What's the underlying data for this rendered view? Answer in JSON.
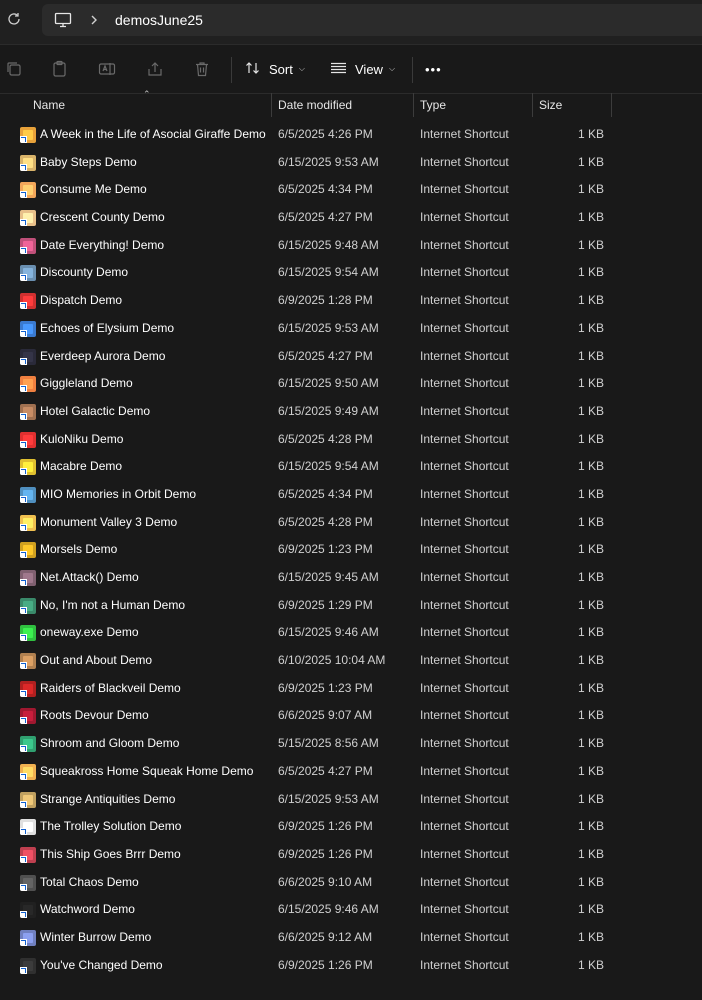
{
  "address": {
    "crumb": "demosJune25"
  },
  "toolbar": {
    "sort_label": "Sort",
    "view_label": "View",
    "more_label": "•••"
  },
  "columns": {
    "name": "Name",
    "date": "Date modified",
    "type": "Type",
    "size": "Size"
  },
  "files": [
    {
      "name": "A Week in the Life of Asocial Giraffe Demo",
      "date": "6/5/2025 4:26 PM",
      "type": "Internet Shortcut",
      "size": "1 KB",
      "color": "#e8a23a"
    },
    {
      "name": "Baby Steps Demo",
      "date": "6/15/2025 9:53 AM",
      "type": "Internet Shortcut",
      "size": "1 KB",
      "color": "#d9b36a"
    },
    {
      "name": "Consume Me Demo",
      "date": "6/5/2025 4:34 PM",
      "type": "Internet Shortcut",
      "size": "1 KB",
      "color": "#f2a65a"
    },
    {
      "name": "Crescent County Demo",
      "date": "6/5/2025 4:27 PM",
      "type": "Internet Shortcut",
      "size": "1 KB",
      "color": "#e8c08a"
    },
    {
      "name": "Date Everything! Demo",
      "date": "6/15/2025 9:48 AM",
      "type": "Internet Shortcut",
      "size": "1 KB",
      "color": "#c0507a"
    },
    {
      "name": "Discounty Demo",
      "date": "6/15/2025 9:54 AM",
      "type": "Internet Shortcut",
      "size": "1 KB",
      "color": "#6a8fb0"
    },
    {
      "name": "Dispatch Demo",
      "date": "6/9/2025 1:28 PM",
      "type": "Internet Shortcut",
      "size": "1 KB",
      "color": "#d03030"
    },
    {
      "name": "Echoes of Elysium Demo",
      "date": "6/15/2025 9:53 AM",
      "type": "Internet Shortcut",
      "size": "1 KB",
      "color": "#3a7ad0"
    },
    {
      "name": "Everdeep Aurora Demo",
      "date": "6/5/2025 4:27 PM",
      "type": "Internet Shortcut",
      "size": "1 KB",
      "color": "#2a2a3a"
    },
    {
      "name": "Giggleland Demo",
      "date": "6/15/2025 9:50 AM",
      "type": "Internet Shortcut",
      "size": "1 KB",
      "color": "#f08040"
    },
    {
      "name": "Hotel Galactic Demo",
      "date": "6/15/2025 9:49 AM",
      "type": "Internet Shortcut",
      "size": "1 KB",
      "color": "#a07050"
    },
    {
      "name": "KuloNiku Demo",
      "date": "6/5/2025 4:28 PM",
      "type": "Internet Shortcut",
      "size": "1 KB",
      "color": "#e03030"
    },
    {
      "name": "Macabre Demo",
      "date": "6/15/2025 9:54 AM",
      "type": "Internet Shortcut",
      "size": "1 KB",
      "color": "#e0c030"
    },
    {
      "name": "MIO Memories in Orbit Demo",
      "date": "6/5/2025 4:34 PM",
      "type": "Internet Shortcut",
      "size": "1 KB",
      "color": "#5090c0"
    },
    {
      "name": "Monument Valley 3 Demo",
      "date": "6/5/2025 4:28 PM",
      "type": "Internet Shortcut",
      "size": "1 KB",
      "color": "#f0c050"
    },
    {
      "name": "Morsels Demo",
      "date": "6/9/2025 1:23 PM",
      "type": "Internet Shortcut",
      "size": "1 KB",
      "color": "#d0a020"
    },
    {
      "name": "Net.Attack() Demo",
      "date": "6/15/2025 9:45 AM",
      "type": "Internet Shortcut",
      "size": "1 KB",
      "color": "#806070"
    },
    {
      "name": "No, I'm not a Human Demo",
      "date": "6/9/2025 1:29 PM",
      "type": "Internet Shortcut",
      "size": "1 KB",
      "color": "#3a8a6a"
    },
    {
      "name": "oneway.exe Demo",
      "date": "6/15/2025 9:46 AM",
      "type": "Internet Shortcut",
      "size": "1 KB",
      "color": "#30c040"
    },
    {
      "name": "Out and About Demo",
      "date": "6/10/2025 10:04 AM",
      "type": "Internet Shortcut",
      "size": "1 KB",
      "color": "#b08050"
    },
    {
      "name": "Raiders of Blackveil Demo",
      "date": "6/9/2025 1:23 PM",
      "type": "Internet Shortcut",
      "size": "1 KB",
      "color": "#b02020"
    },
    {
      "name": "Roots Devour Demo",
      "date": "6/6/2025 9:07 AM",
      "type": "Internet Shortcut",
      "size": "1 KB",
      "color": "#a01830"
    },
    {
      "name": "Shroom and Gloom Demo",
      "date": "5/15/2025 8:56 AM",
      "type": "Internet Shortcut",
      "size": "1 KB",
      "color": "#30a070"
    },
    {
      "name": "Squeakross Home Squeak Home Demo",
      "date": "6/5/2025 4:27 PM",
      "type": "Internet Shortcut",
      "size": "1 KB",
      "color": "#f0b050"
    },
    {
      "name": "Strange Antiquities Demo",
      "date": "6/15/2025 9:53 AM",
      "type": "Internet Shortcut",
      "size": "1 KB",
      "color": "#c0a060"
    },
    {
      "name": "The Trolley Solution Demo",
      "date": "6/9/2025 1:26 PM",
      "type": "Internet Shortcut",
      "size": "1 KB",
      "color": "#e0e0e0"
    },
    {
      "name": "This Ship Goes Brrr Demo",
      "date": "6/9/2025 1:26 PM",
      "type": "Internet Shortcut",
      "size": "1 KB",
      "color": "#c04050"
    },
    {
      "name": "Total Chaos Demo",
      "date": "6/6/2025 9:10 AM",
      "type": "Internet Shortcut",
      "size": "1 KB",
      "color": "#505050"
    },
    {
      "name": "Watchword Demo",
      "date": "6/15/2025 9:46 AM",
      "type": "Internet Shortcut",
      "size": "1 KB",
      "color": "#202020"
    },
    {
      "name": "Winter Burrow Demo",
      "date": "6/6/2025 9:12 AM",
      "type": "Internet Shortcut",
      "size": "1 KB",
      "color": "#7080c0"
    },
    {
      "name": "You've Changed Demo",
      "date": "6/9/2025 1:26 PM",
      "type": "Internet Shortcut",
      "size": "1 KB",
      "color": "#303030"
    }
  ]
}
